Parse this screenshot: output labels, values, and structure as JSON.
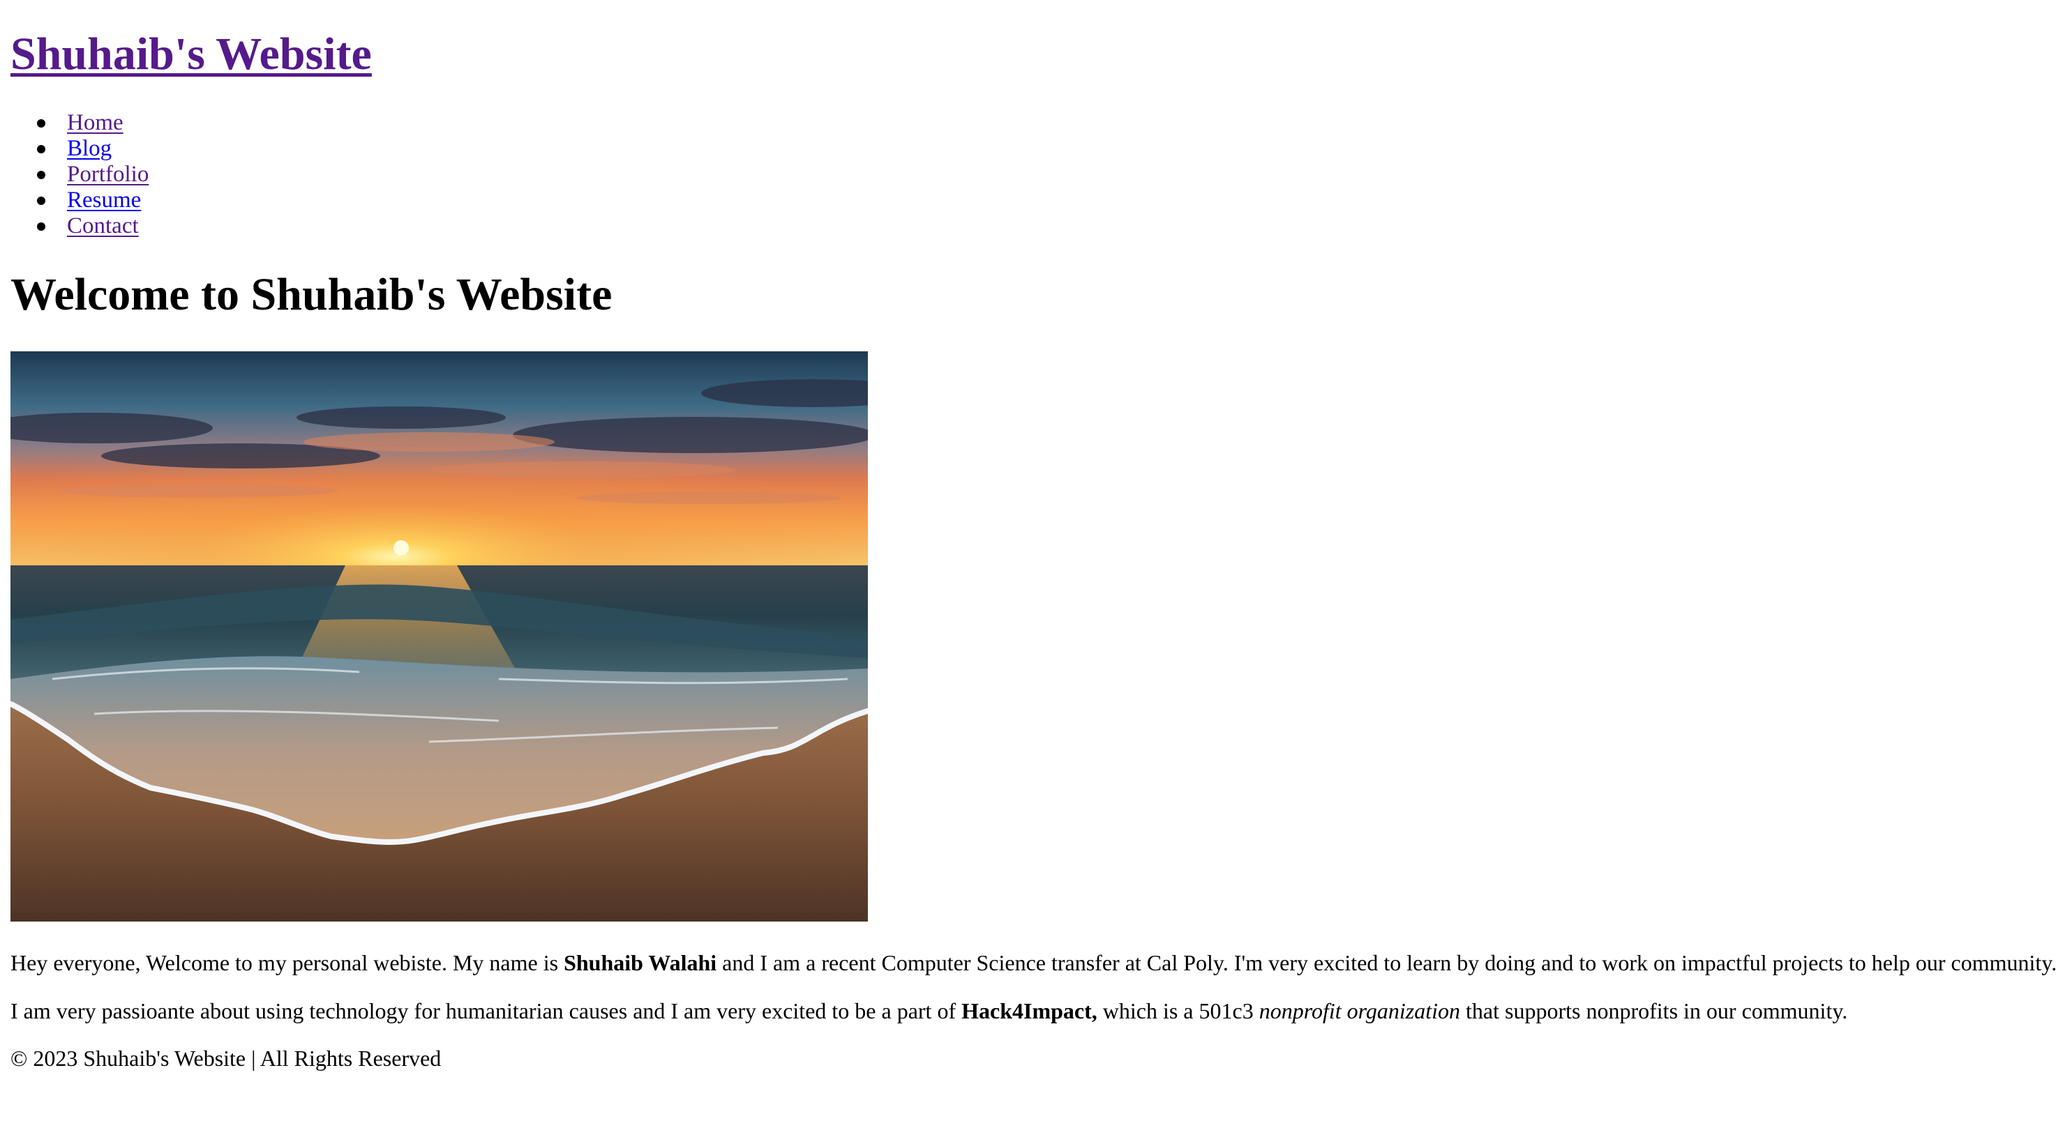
{
  "site": {
    "title": "Shuhaib's Website"
  },
  "nav": {
    "items": [
      {
        "label": "Home"
      },
      {
        "label": "Blog"
      },
      {
        "label": "Portfolio"
      },
      {
        "label": "Resume"
      },
      {
        "label": "Contact"
      }
    ]
  },
  "main": {
    "heading": "Welcome to Shuhaib's Website",
    "image_alt": "Sunset over the ocean with a wave washing onto a sandy beach",
    "paragraph1": {
      "before": "Hey everyone, Welcome to my personal webiste. My name is ",
      "name": "Shuhaib Walahi",
      "after": " and I am a recent Computer Science transfer at Cal Poly. I'm very excited to learn by doing and to work on impactful projects to help our community."
    },
    "paragraph2": {
      "before": "I am very passioante about using technology for humanitarian causes and I am very excited to be a part of ",
      "org": "Hack4Impact,",
      "middle": " which is a 501c3 ",
      "emphasis": "nonprofit organization",
      "after": " that supports nonprofits in our community."
    }
  },
  "footer": {
    "text": "© 2023 Shuhaib's Website | All Rights Reserved"
  },
  "colors": {
    "visited_link": "#551a8b",
    "unvisited_link": "#0000ee",
    "text": "#000000",
    "background": "#ffffff"
  }
}
